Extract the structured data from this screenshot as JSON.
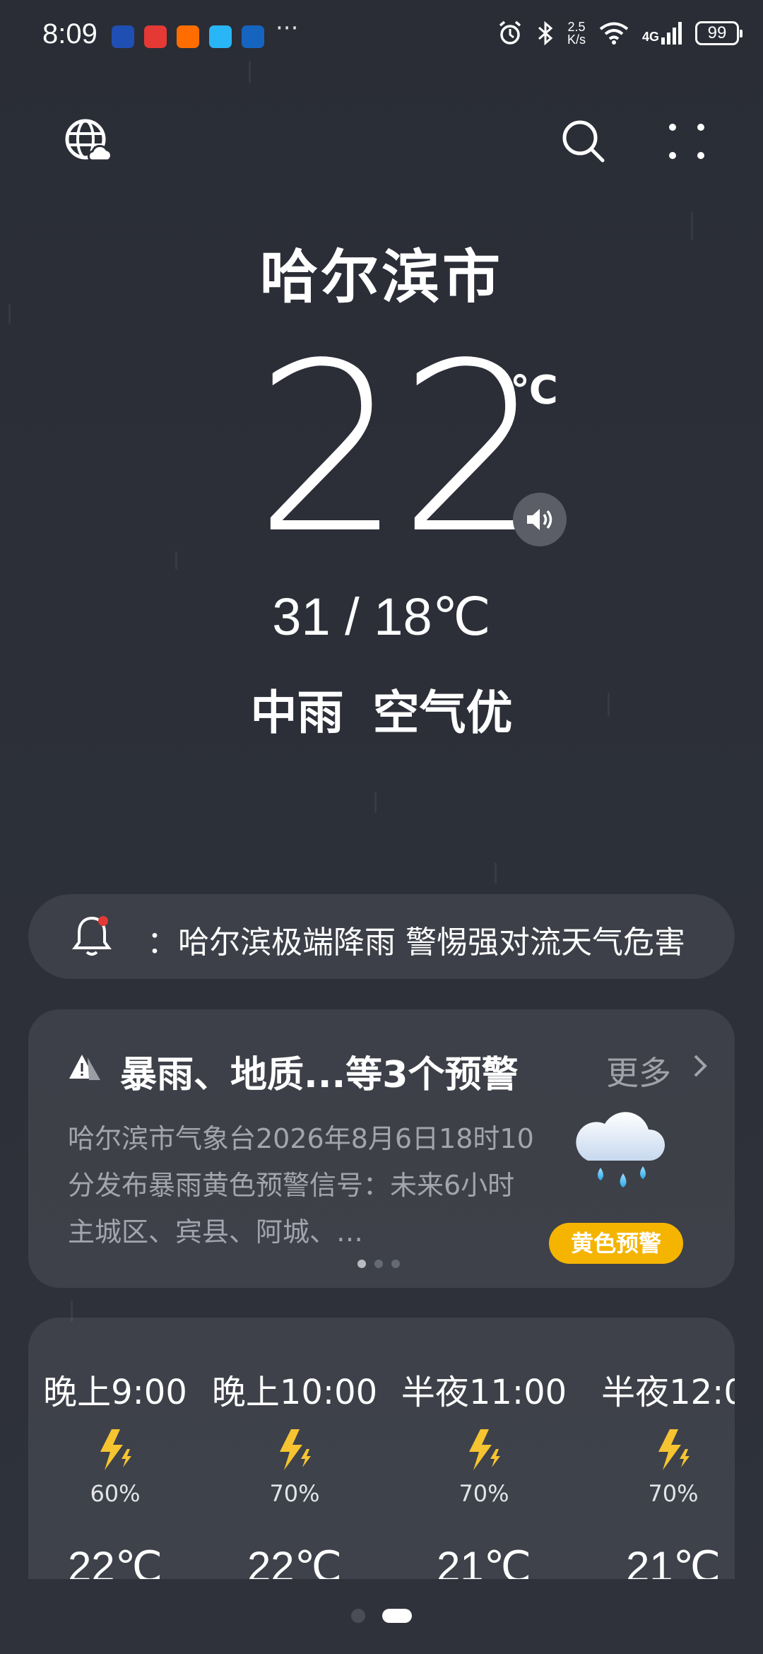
{
  "status_bar": {
    "time": "8:09",
    "overflow": "···",
    "net_speed_top": "2.5",
    "net_speed_bottom": "K/s",
    "network": "4G",
    "battery": "99"
  },
  "toolbar": {
    "globe_icon": "globe-cloud-icon",
    "search_icon": "search-icon",
    "menu_icon": "grid-dots-icon"
  },
  "hero": {
    "city": "哈尔滨市",
    "temperature": "22",
    "unit": "℃",
    "range": "31 / 18℃",
    "condition": "中雨  空气优"
  },
  "marquee": {
    "text": "：哈尔滨极端降雨 警惕强对流天气危害"
  },
  "alert": {
    "title": "暴雨、地质...等3个预警",
    "more": "更多",
    "body": "哈尔滨市气象台2026年8月6日18时10分发布暴雨黄色预警信号：未来6小时主城区、宾县、阿城、…",
    "badge": "黄色预警",
    "badge_color": "#f4b400",
    "page_total": 3,
    "page_current": 1
  },
  "hourly": [
    {
      "time": "晚上9:00",
      "prob": "60%",
      "temp": "22℃",
      "icon": "thunder-icon"
    },
    {
      "time": "晚上10:00",
      "prob": "70%",
      "temp": "22℃",
      "icon": "thunder-icon"
    },
    {
      "time": "半夜11:00",
      "prob": "70%",
      "temp": "21℃",
      "icon": "thunder-icon"
    },
    {
      "time": "半夜12:0",
      "prob": "70%",
      "temp": "21℃",
      "icon": "thunder-icon"
    }
  ],
  "pager": {
    "total": 2,
    "current": 2
  }
}
